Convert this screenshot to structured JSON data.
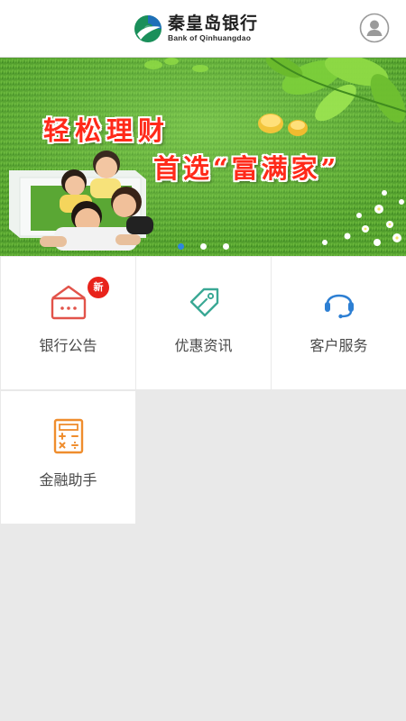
{
  "header": {
    "logo_cn": "秦皇岛银行",
    "logo_en": "Bank of Qinhuangdao",
    "user_icon": "user-avatar-icon"
  },
  "banner": {
    "line1": "轻松理财",
    "line2": "首选“富满家”",
    "slides_count": 3,
    "active_slide": 1
  },
  "menu": {
    "items": [
      {
        "label": "银行公告",
        "icon": "notice-house-icon",
        "badge": "新",
        "color": "#e2534a"
      },
      {
        "label": "优惠资讯",
        "icon": "tag-icon",
        "color": "#3aa895"
      },
      {
        "label": "客户服务",
        "icon": "headset-icon",
        "color": "#2d7fd3"
      },
      {
        "label": "金融助手",
        "icon": "calculator-icon",
        "color": "#ef8d2d"
      }
    ]
  }
}
